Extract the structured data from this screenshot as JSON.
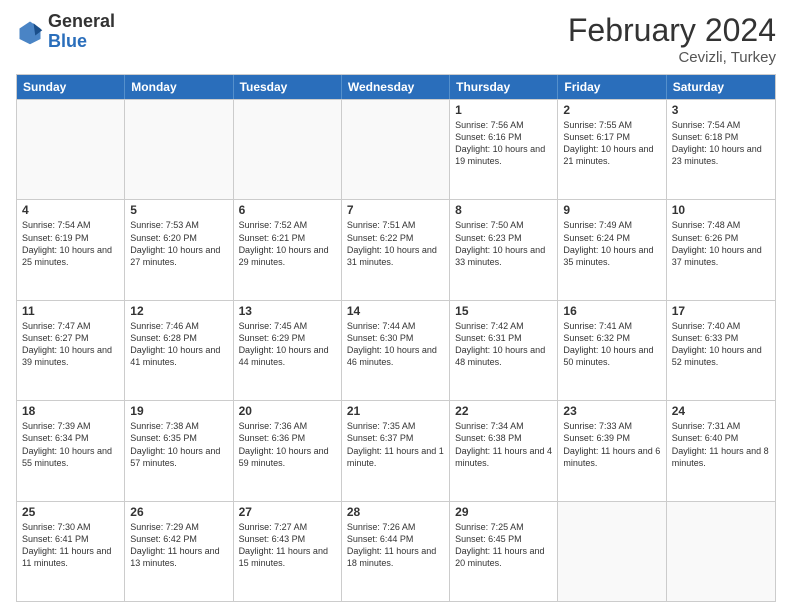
{
  "header": {
    "logo_general": "General",
    "logo_blue": "Blue",
    "title": "February 2024",
    "subtitle": "Cevizli, Turkey"
  },
  "calendar": {
    "days_of_week": [
      "Sunday",
      "Monday",
      "Tuesday",
      "Wednesday",
      "Thursday",
      "Friday",
      "Saturday"
    ],
    "weeks": [
      [
        {
          "day": "",
          "empty": true
        },
        {
          "day": "",
          "empty": true
        },
        {
          "day": "",
          "empty": true
        },
        {
          "day": "",
          "empty": true
        },
        {
          "day": "1",
          "sunrise": "7:56 AM",
          "sunset": "6:16 PM",
          "daylight": "10 hours and 19 minutes."
        },
        {
          "day": "2",
          "sunrise": "7:55 AM",
          "sunset": "6:17 PM",
          "daylight": "10 hours and 21 minutes."
        },
        {
          "day": "3",
          "sunrise": "7:54 AM",
          "sunset": "6:18 PM",
          "daylight": "10 hours and 23 minutes."
        }
      ],
      [
        {
          "day": "4",
          "sunrise": "7:54 AM",
          "sunset": "6:19 PM",
          "daylight": "10 hours and 25 minutes."
        },
        {
          "day": "5",
          "sunrise": "7:53 AM",
          "sunset": "6:20 PM",
          "daylight": "10 hours and 27 minutes."
        },
        {
          "day": "6",
          "sunrise": "7:52 AM",
          "sunset": "6:21 PM",
          "daylight": "10 hours and 29 minutes."
        },
        {
          "day": "7",
          "sunrise": "7:51 AM",
          "sunset": "6:22 PM",
          "daylight": "10 hours and 31 minutes."
        },
        {
          "day": "8",
          "sunrise": "7:50 AM",
          "sunset": "6:23 PM",
          "daylight": "10 hours and 33 minutes."
        },
        {
          "day": "9",
          "sunrise": "7:49 AM",
          "sunset": "6:24 PM",
          "daylight": "10 hours and 35 minutes."
        },
        {
          "day": "10",
          "sunrise": "7:48 AM",
          "sunset": "6:26 PM",
          "daylight": "10 hours and 37 minutes."
        }
      ],
      [
        {
          "day": "11",
          "sunrise": "7:47 AM",
          "sunset": "6:27 PM",
          "daylight": "10 hours and 39 minutes."
        },
        {
          "day": "12",
          "sunrise": "7:46 AM",
          "sunset": "6:28 PM",
          "daylight": "10 hours and 41 minutes."
        },
        {
          "day": "13",
          "sunrise": "7:45 AM",
          "sunset": "6:29 PM",
          "daylight": "10 hours and 44 minutes."
        },
        {
          "day": "14",
          "sunrise": "7:44 AM",
          "sunset": "6:30 PM",
          "daylight": "10 hours and 46 minutes."
        },
        {
          "day": "15",
          "sunrise": "7:42 AM",
          "sunset": "6:31 PM",
          "daylight": "10 hours and 48 minutes."
        },
        {
          "day": "16",
          "sunrise": "7:41 AM",
          "sunset": "6:32 PM",
          "daylight": "10 hours and 50 minutes."
        },
        {
          "day": "17",
          "sunrise": "7:40 AM",
          "sunset": "6:33 PM",
          "daylight": "10 hours and 52 minutes."
        }
      ],
      [
        {
          "day": "18",
          "sunrise": "7:39 AM",
          "sunset": "6:34 PM",
          "daylight": "10 hours and 55 minutes."
        },
        {
          "day": "19",
          "sunrise": "7:38 AM",
          "sunset": "6:35 PM",
          "daylight": "10 hours and 57 minutes."
        },
        {
          "day": "20",
          "sunrise": "7:36 AM",
          "sunset": "6:36 PM",
          "daylight": "10 hours and 59 minutes."
        },
        {
          "day": "21",
          "sunrise": "7:35 AM",
          "sunset": "6:37 PM",
          "daylight": "11 hours and 1 minute."
        },
        {
          "day": "22",
          "sunrise": "7:34 AM",
          "sunset": "6:38 PM",
          "daylight": "11 hours and 4 minutes."
        },
        {
          "day": "23",
          "sunrise": "7:33 AM",
          "sunset": "6:39 PM",
          "daylight": "11 hours and 6 minutes."
        },
        {
          "day": "24",
          "sunrise": "7:31 AM",
          "sunset": "6:40 PM",
          "daylight": "11 hours and 8 minutes."
        }
      ],
      [
        {
          "day": "25",
          "sunrise": "7:30 AM",
          "sunset": "6:41 PM",
          "daylight": "11 hours and 11 minutes."
        },
        {
          "day": "26",
          "sunrise": "7:29 AM",
          "sunset": "6:42 PM",
          "daylight": "11 hours and 13 minutes."
        },
        {
          "day": "27",
          "sunrise": "7:27 AM",
          "sunset": "6:43 PM",
          "daylight": "11 hours and 15 minutes."
        },
        {
          "day": "28",
          "sunrise": "7:26 AM",
          "sunset": "6:44 PM",
          "daylight": "11 hours and 18 minutes."
        },
        {
          "day": "29",
          "sunrise": "7:25 AM",
          "sunset": "6:45 PM",
          "daylight": "11 hours and 20 minutes."
        },
        {
          "day": "",
          "empty": true
        },
        {
          "day": "",
          "empty": true
        }
      ]
    ]
  }
}
